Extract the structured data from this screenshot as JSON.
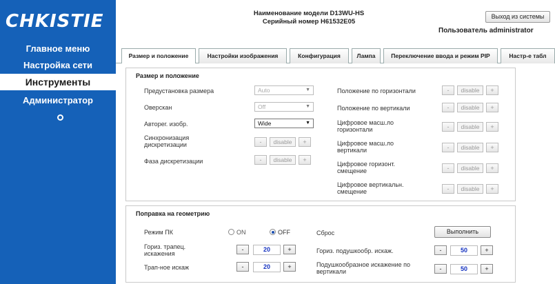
{
  "sidebar": {
    "logo": "CHKISTIE",
    "items": [
      {
        "label": "Главное меню"
      },
      {
        "label": "Настройка сети"
      },
      {
        "label": "Инструменты",
        "active": true
      },
      {
        "label": "Администратор"
      }
    ]
  },
  "header": {
    "model_name": "Наименование модели D13WU-HS",
    "serial": "Серийный номер H61532E05",
    "logout_label": "Выход из системы",
    "user_label": "Пользователь administrator"
  },
  "tabs": [
    {
      "label": "Размер и положение",
      "active": true
    },
    {
      "label": "Настройки изображения"
    },
    {
      "label": "Конфигурация"
    },
    {
      "label": "Лампа"
    },
    {
      "label": "Переключение ввода и режим PIP"
    },
    {
      "label": "Настр-е табл"
    }
  ],
  "size_position": {
    "title": "Размер и положение",
    "preset": {
      "label": "Предустановка размера",
      "value": "Auto"
    },
    "overscan": {
      "label": "Оверскан",
      "value": "Off"
    },
    "auto_adjust": {
      "label": "Авторег. изобр.",
      "value": "Wide"
    },
    "pixel_track": {
      "label": "Синхронизация дискретизации",
      "value": "disable"
    },
    "pixel_phase": {
      "label": "Фаза дискретизации",
      "value": "disable"
    },
    "h_position": {
      "label": "Положение по горизонтали",
      "value": "disable"
    },
    "v_position": {
      "label": "Положение по вертикали",
      "value": "disable"
    },
    "digital_h_zoom": {
      "label": "Цифровое масш.ло горизонтали",
      "value": "disable"
    },
    "digital_v_zoom": {
      "label": "Цифровое масш.ло вертикали",
      "value": "disable"
    },
    "digital_h_shift": {
      "label": "Цифровое горизонт. смещение",
      "value": "disable"
    },
    "digital_v_shift": {
      "label": "Цифровое вертикальн. смещение",
      "value": "disable"
    },
    "minus": "-",
    "plus": "+"
  },
  "geometry": {
    "title": "Поправка на геометрию",
    "pc_mode": {
      "label": "Режим ПК",
      "on": "ON",
      "off": "OFF",
      "selected": "OFF"
    },
    "reset": {
      "label": "Сброс",
      "button": "Выполнить"
    },
    "h_keystone": {
      "label": "Гориз. трапец. искажения",
      "value": "20"
    },
    "v_keystone": {
      "label": "Трап-ное искаж",
      "value": "20"
    },
    "h_pincushion": {
      "label": "Гориз. подушкообр. искаж.",
      "value": "50"
    },
    "v_pincushion": {
      "label": "Подушкообразное искажение по вертикали",
      "value": "50"
    },
    "minus": "-",
    "plus": "+"
  },
  "colors": {
    "sidebar_bg": "#1561b8",
    "value_blue": "#1633c0"
  }
}
